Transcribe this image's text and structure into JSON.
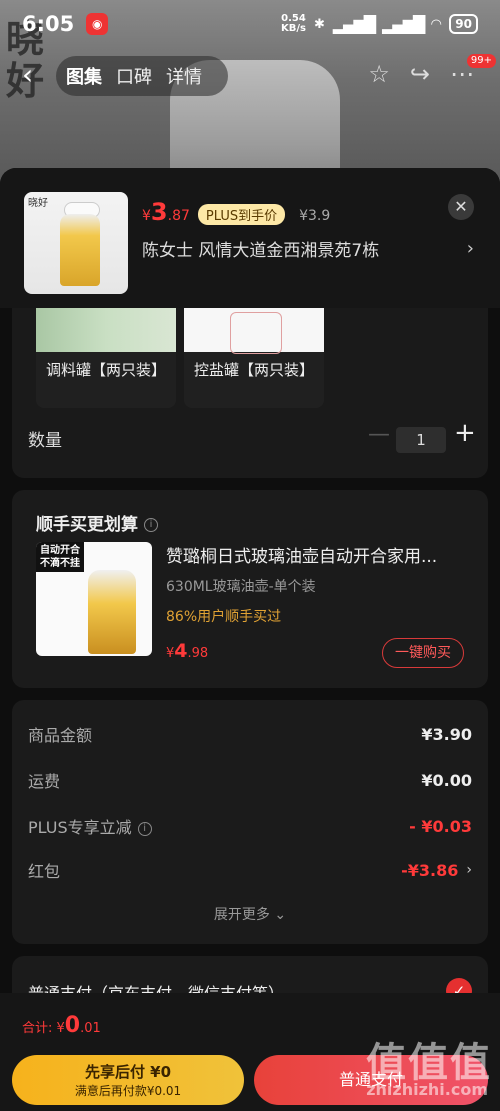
{
  "status_bar": {
    "time": "6:05",
    "net_speed": "0.54\nKB/s",
    "battery": "90"
  },
  "background": {
    "calligraphy": "晓\n好"
  },
  "nav": {
    "back": "‹",
    "tabs": [
      "图集",
      "口碑",
      "详情"
    ],
    "badge": "99+"
  },
  "product": {
    "currency": "¥",
    "price_int": "3",
    "price_dec": ".87",
    "plus_label": "PLUS到手价",
    "orig_price": "¥3.9",
    "address": "陈女士  风情大道金西湘景苑7栋"
  },
  "variants": [
    {
      "label": "调料罐【两只装】"
    },
    {
      "label": "控盐罐【两只装】"
    }
  ],
  "quantity": {
    "label": "数量",
    "value": "1"
  },
  "bundle": {
    "title": "顺手买更划算",
    "tag": "自动开合\n不滴不挂",
    "name": "赞璐桐日式玻璃油壶自动开合家用...",
    "spec": "630ML玻璃油壶-单个装",
    "bought": "86%用户顺手买过",
    "currency": "¥",
    "price_int": "4",
    "price_dec": ".98",
    "buy_label": "一键购买"
  },
  "summary": {
    "rows": [
      {
        "label": "商品金额",
        "value": "¥3.90"
      },
      {
        "label": "运费",
        "value": "¥0.00"
      },
      {
        "label": "PLUS专享立减",
        "value": "- ¥0.03"
      },
      {
        "label": "红包",
        "value": "-¥3.86"
      }
    ],
    "expand_label": "展开更多 ⌄"
  },
  "payment": {
    "title": "普通支付（京东支付、微信支付等）"
  },
  "footer": {
    "total_label": "合计: ",
    "total_currency": "¥",
    "total_int": "0",
    "total_dec": ".01",
    "later_line1": "先享后付 ¥0",
    "later_line2": "满意后再付款¥0.01",
    "pay_label": "普通支付"
  },
  "watermark": {
    "text": "值值值",
    "url": "zhizhizhi.com"
  },
  "colors": {
    "accent_red": "#ff3a3a",
    "plus_gold": "#fde8a6",
    "later_yellow": "#f6b21c"
  }
}
